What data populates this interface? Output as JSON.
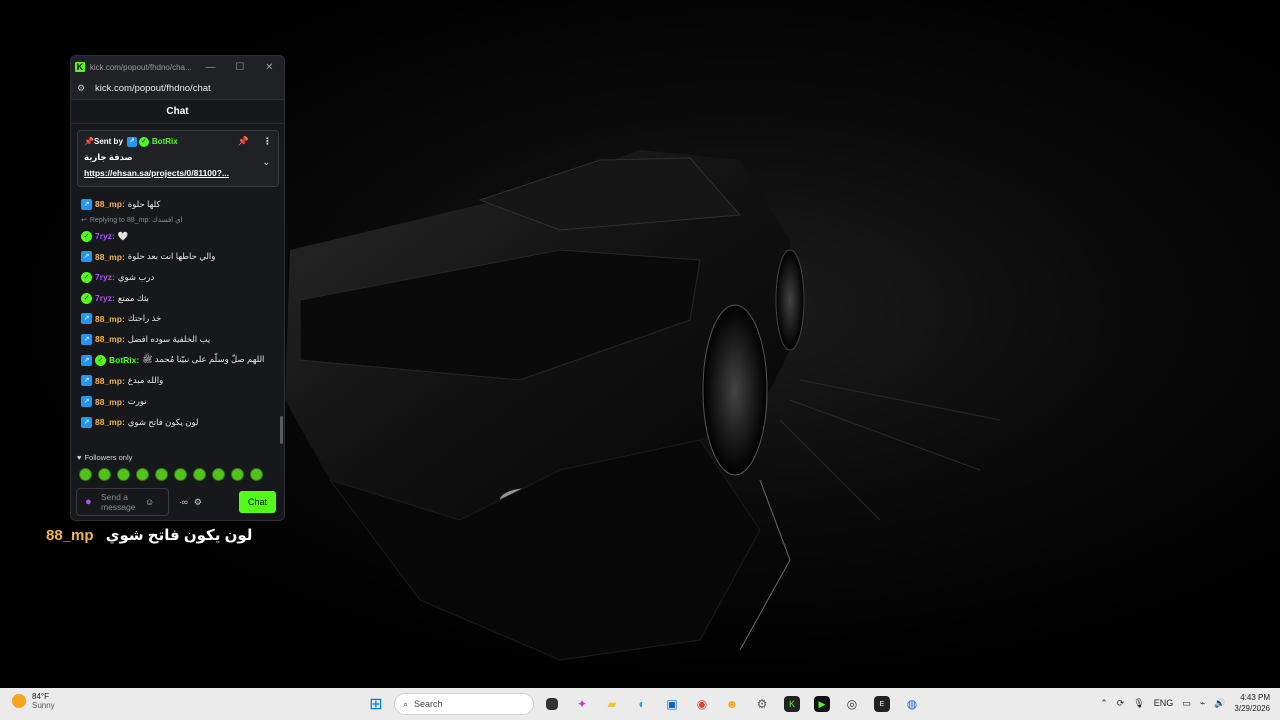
{
  "window": {
    "title": "kick.com/popout/fhdno/cha...",
    "url": "kick.com/popout/fhdno/chat",
    "header": "Chat"
  },
  "pinned": {
    "sent_by": "Sent by",
    "bot_name": "BotRix",
    "message": "صدقة جارية",
    "link": "https://ehsan.sa/projects/0/81100?..."
  },
  "messages": [
    {
      "user": "88_mp",
      "text": "كلها حلوة",
      "badge": "kick",
      "color": "#f3b44d"
    },
    {
      "reply": "Replying to 88_mp: اي افسدك"
    },
    {
      "user": "7ryz",
      "text": "🤍",
      "badge": "verified",
      "color": "#b44dff"
    },
    {
      "user": "88_mp",
      "text": "والي حاطها انت بعد حلوة",
      "badge": "kick",
      "color": "#f3b44d"
    },
    {
      "user": "7ryz",
      "text": "درب شوي",
      "badge": "verified",
      "color": "#b44dff"
    },
    {
      "user": "7ryz",
      "text": "بثك ممتع",
      "badge": "verified",
      "color": "#b44dff"
    },
    {
      "user": "88_mp",
      "text": "خذ راحتك",
      "badge": "kick",
      "color": "#f3b44d"
    },
    {
      "user": "88_mp",
      "text": "يب الخلفية سوده افضل",
      "badge": "kick",
      "color": "#f3b44d"
    },
    {
      "user": "BotRix",
      "text": "اللهم صلّ وسلّم على نبيّنا مُحمد ﷺ",
      "badge": "bot",
      "color": "#53fc18"
    },
    {
      "user": "88_mp",
      "text": "والله مبدع",
      "badge": "kick",
      "color": "#f3b44d"
    },
    {
      "user": "88_mp",
      "text": "نورت",
      "badge": "kick",
      "color": "#f3b44d"
    },
    {
      "user": "88_mp",
      "text": "لون يكون فاتح شوي",
      "badge": "kick",
      "color": "#f3b44d"
    }
  ],
  "followers_only": "Followers only",
  "input": {
    "placeholder_line1": "Send a",
    "placeholder_line2": "message",
    "chat_button": "Chat"
  },
  "overlay": {
    "user": "88_mp",
    "text": "لون يكون فاتح شوي"
  },
  "taskbar": {
    "weather_temp": "84°F",
    "weather_desc": "Sunny",
    "search_label": "Search",
    "language": "ENG",
    "time": "4:43 PM",
    "date": "3/29/2026"
  }
}
